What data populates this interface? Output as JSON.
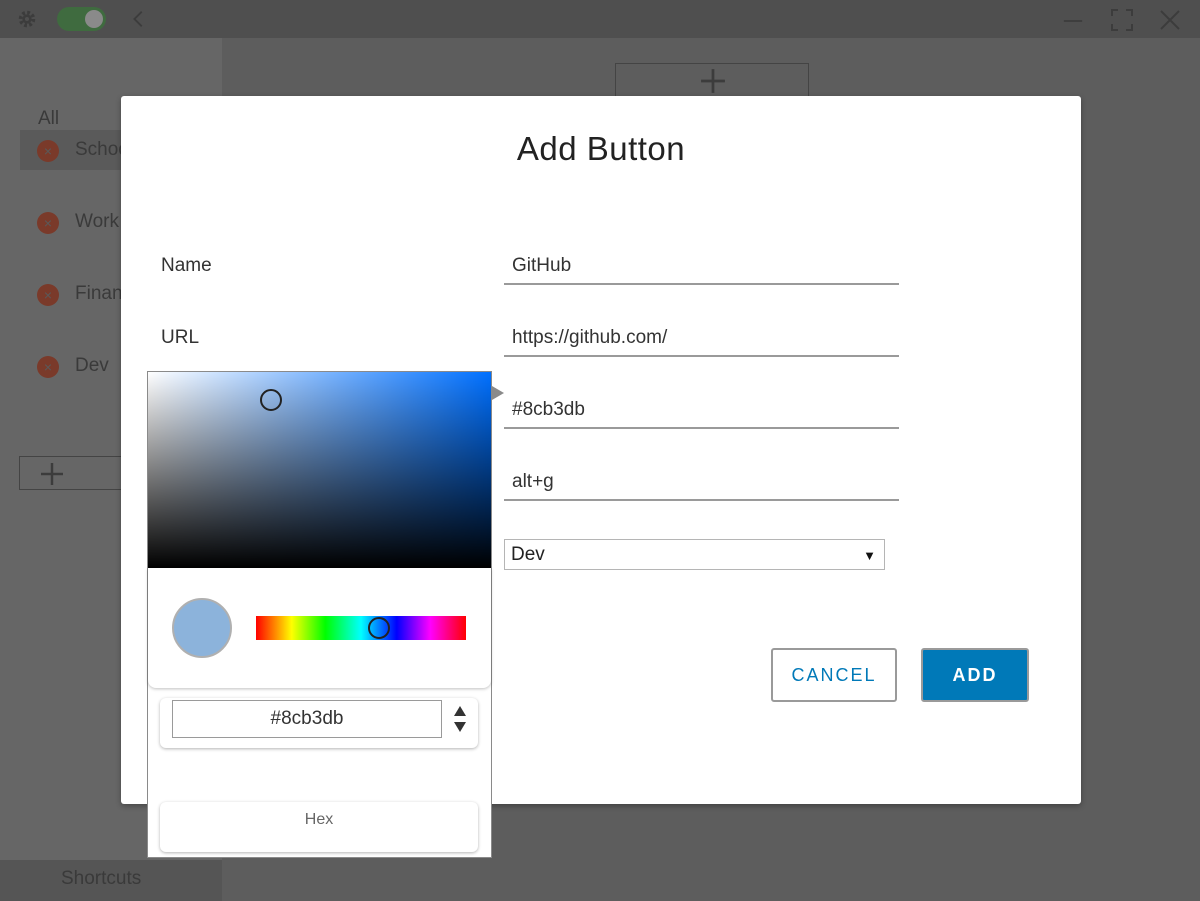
{
  "titlebar": {
    "settings_icon": "gear-icon",
    "toggle_state": "on",
    "back_icon": "chevron-left-icon",
    "minimize_icon": "minimize-icon",
    "maximize_icon": "fullscreen-icon",
    "close_icon": "close-icon"
  },
  "sidebar": {
    "all_label": "All",
    "items": [
      {
        "label": "School"
      },
      {
        "label": "Work"
      },
      {
        "label": "Finance"
      },
      {
        "label": "Dev"
      }
    ],
    "add_icon": "plus-icon",
    "footer_label": "Shortcuts"
  },
  "modal": {
    "title": "Add Button",
    "name_label": "Name",
    "name_value": "GitHub",
    "url_label": "URL",
    "url_value": "https://github.com/",
    "color_value": "#8cb3db",
    "shortcut_value": "alt+g",
    "group_value": "Dev",
    "cancel_label": "CANCEL",
    "add_label": "ADD"
  },
  "picker": {
    "preview_color": "#8cb3db",
    "hex_value": "#8cb3db",
    "mode_label": "Hex"
  },
  "colors": {
    "accent": "#0079b8",
    "swatch": "#8cb3db"
  }
}
